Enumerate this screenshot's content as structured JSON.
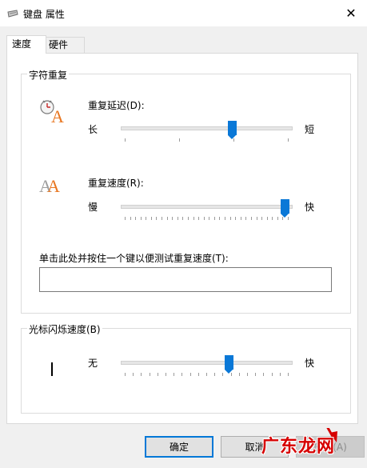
{
  "window": {
    "title": "键盘 属性",
    "close_glyph": "✕"
  },
  "tabs": [
    {
      "label": "速度",
      "active": true
    },
    {
      "label": "硬件",
      "active": false
    }
  ],
  "char_repeat": {
    "group_label": "字符重复",
    "delay": {
      "label": "重复延迟(D):",
      "left": "长",
      "right": "短",
      "level": 0.67,
      "ticks": 4
    },
    "rate": {
      "label": "重复速度(R):",
      "left": "慢",
      "right": "快",
      "level": 1.0,
      "ticks": 32
    },
    "test_label": "单击此处并按住一个键以便测试重复速度(T):",
    "test_value": ""
  },
  "cursor_blink": {
    "group_label": "光标闪烁速度(B)",
    "left": "无",
    "right": "快",
    "level": 0.65,
    "ticks": 21
  },
  "buttons": {
    "ok": "确定",
    "cancel": "取消",
    "apply": "应用(A)"
  },
  "watermark": {
    "text": "广东龙网"
  },
  "colors": {
    "accent": "#0a78d7",
    "watermark_red": "#d60000"
  }
}
